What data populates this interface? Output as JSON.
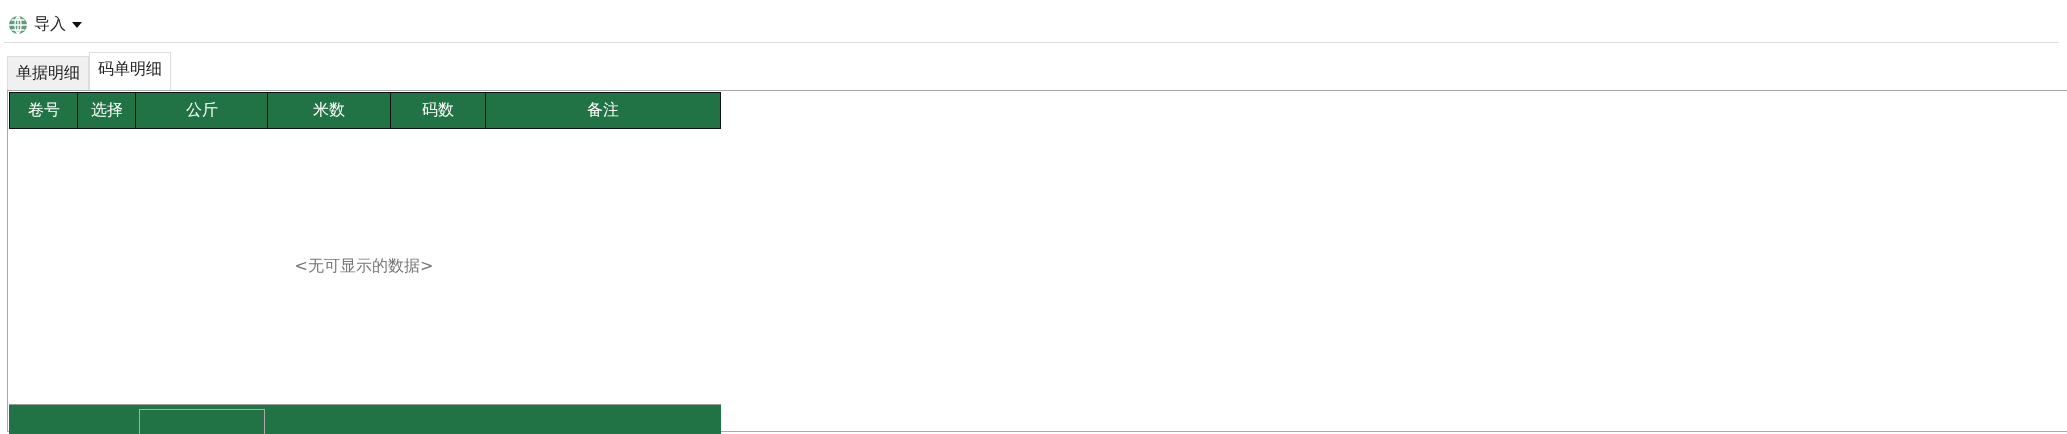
{
  "toolbar": {
    "import_button": {
      "label": "导入"
    }
  },
  "tabs": [
    {
      "label": "单据明细",
      "selected": false
    },
    {
      "label": "码单明细",
      "selected": true
    }
  ],
  "grid": {
    "columns": [
      {
        "label": "卷号"
      },
      {
        "label": "选择"
      },
      {
        "label": "公斤"
      },
      {
        "label": "米数"
      },
      {
        "label": "码数"
      },
      {
        "label": "备注"
      }
    ],
    "empty_text": "<无可显示的数据>"
  }
}
